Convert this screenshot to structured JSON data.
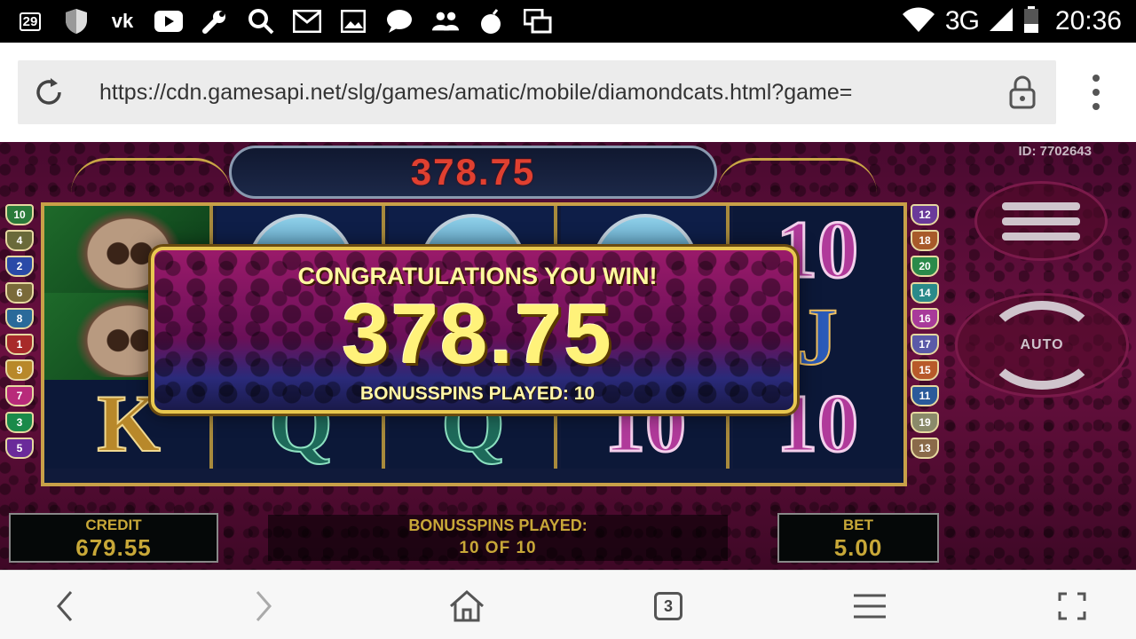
{
  "status_bar": {
    "notification_count": "29",
    "network": "3G",
    "time": "20:36",
    "icons": [
      "notification-count-icon",
      "shield-icon",
      "vk-icon",
      "youtube-icon",
      "wrench-icon",
      "search-icon",
      "gmail-icon",
      "gallery-icon",
      "chat-icon",
      "people-icon",
      "bomb-icon",
      "screens-icon",
      "wifi-icon",
      "signal-icon",
      "battery-icon"
    ]
  },
  "browser": {
    "url": "https://cdn.gamesapi.net/slg/games/amatic/mobile/diamondcats.html?game=",
    "tab_count": "3"
  },
  "game": {
    "id_label": "ID: 7702643",
    "top_win_display": "378.75",
    "win_popup": {
      "title": "CONGRATULATIONS YOU WIN!",
      "amount": "378.75",
      "subtitle": "BONUSSPINS PLAYED: 10"
    },
    "left_lines": [
      "10",
      "4",
      "2",
      "6",
      "8",
      "1",
      "9",
      "7",
      "3",
      "5"
    ],
    "right_lines": [
      "12",
      "18",
      "20",
      "14",
      "16",
      "17",
      "15",
      "11",
      "19",
      "13"
    ],
    "reels": [
      [
        "cat",
        "cat",
        "K"
      ],
      [
        "heart",
        "",
        "Q"
      ],
      [
        "heart",
        "",
        "Q"
      ],
      [
        "heart",
        "",
        "10"
      ],
      [
        "10",
        "J",
        "10"
      ]
    ],
    "auto_label": "AUTO",
    "credit": {
      "label": "CREDIT",
      "value": "679.55"
    },
    "bonus_spins": {
      "label": "BONUSSPINS PLAYED:",
      "value": "10 OF 10"
    },
    "bet": {
      "label": "BET",
      "value": "5.00"
    },
    "colors": {
      "accent_gold": "#e8c850",
      "panel_text": "#c8a838",
      "win_text": "#fff27a"
    }
  }
}
